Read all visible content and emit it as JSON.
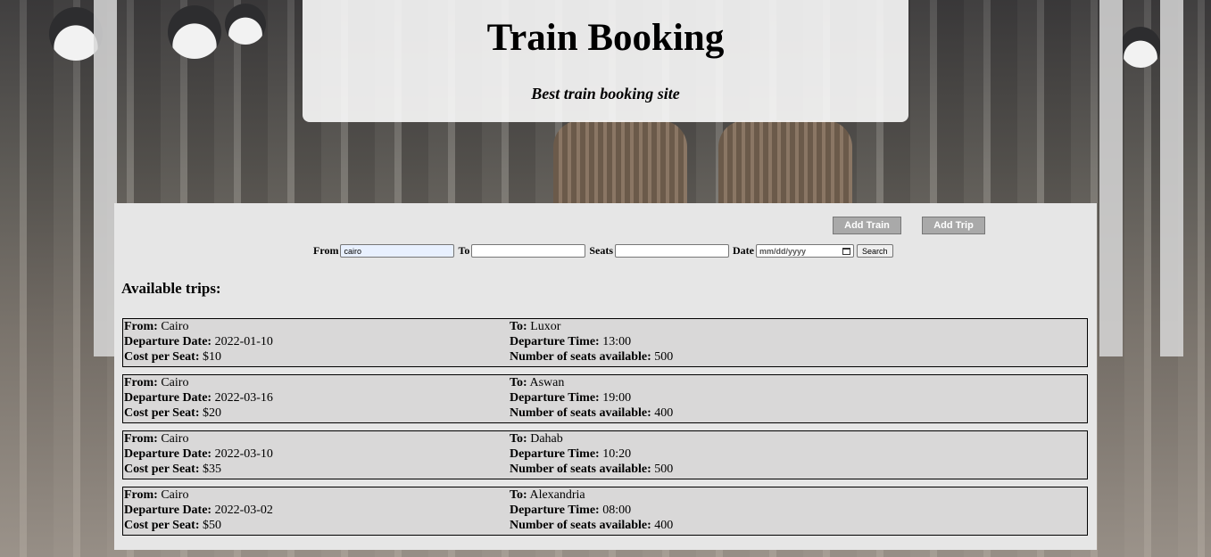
{
  "header": {
    "title": "Train Booking",
    "subtitle": "Best train booking site"
  },
  "admin": {
    "add_train": "Add Train",
    "add_trip": "Add Trip"
  },
  "search": {
    "from_label": "From",
    "from_value": "cairo",
    "to_label": "To",
    "to_value": "",
    "seats_label": "Seats",
    "seats_value": "",
    "date_label": "Date",
    "date_placeholder": "mm/dd/yyyy",
    "search_button": "Search"
  },
  "trips_title": "Available trips:",
  "field_labels": {
    "from": "From:",
    "to": "To:",
    "departure_date": "Departure Date:",
    "departure_time": "Departure Time:",
    "cost": "Cost per Seat:",
    "seats": "Number of seats available:"
  },
  "trips": [
    {
      "from": "Cairo",
      "to": "Luxor",
      "date": "2022-01-10",
      "time": "13:00",
      "cost": "$10",
      "seats": "500"
    },
    {
      "from": "Cairo",
      "to": "Aswan",
      "date": "2022-03-16",
      "time": "19:00",
      "cost": "$20",
      "seats": "400"
    },
    {
      "from": "Cairo",
      "to": "Dahab",
      "date": "2022-03-10",
      "time": "10:20",
      "cost": "$35",
      "seats": "500"
    },
    {
      "from": "Cairo",
      "to": "Alexandria",
      "date": "2022-03-02",
      "time": "08:00",
      "cost": "$50",
      "seats": "400"
    }
  ]
}
